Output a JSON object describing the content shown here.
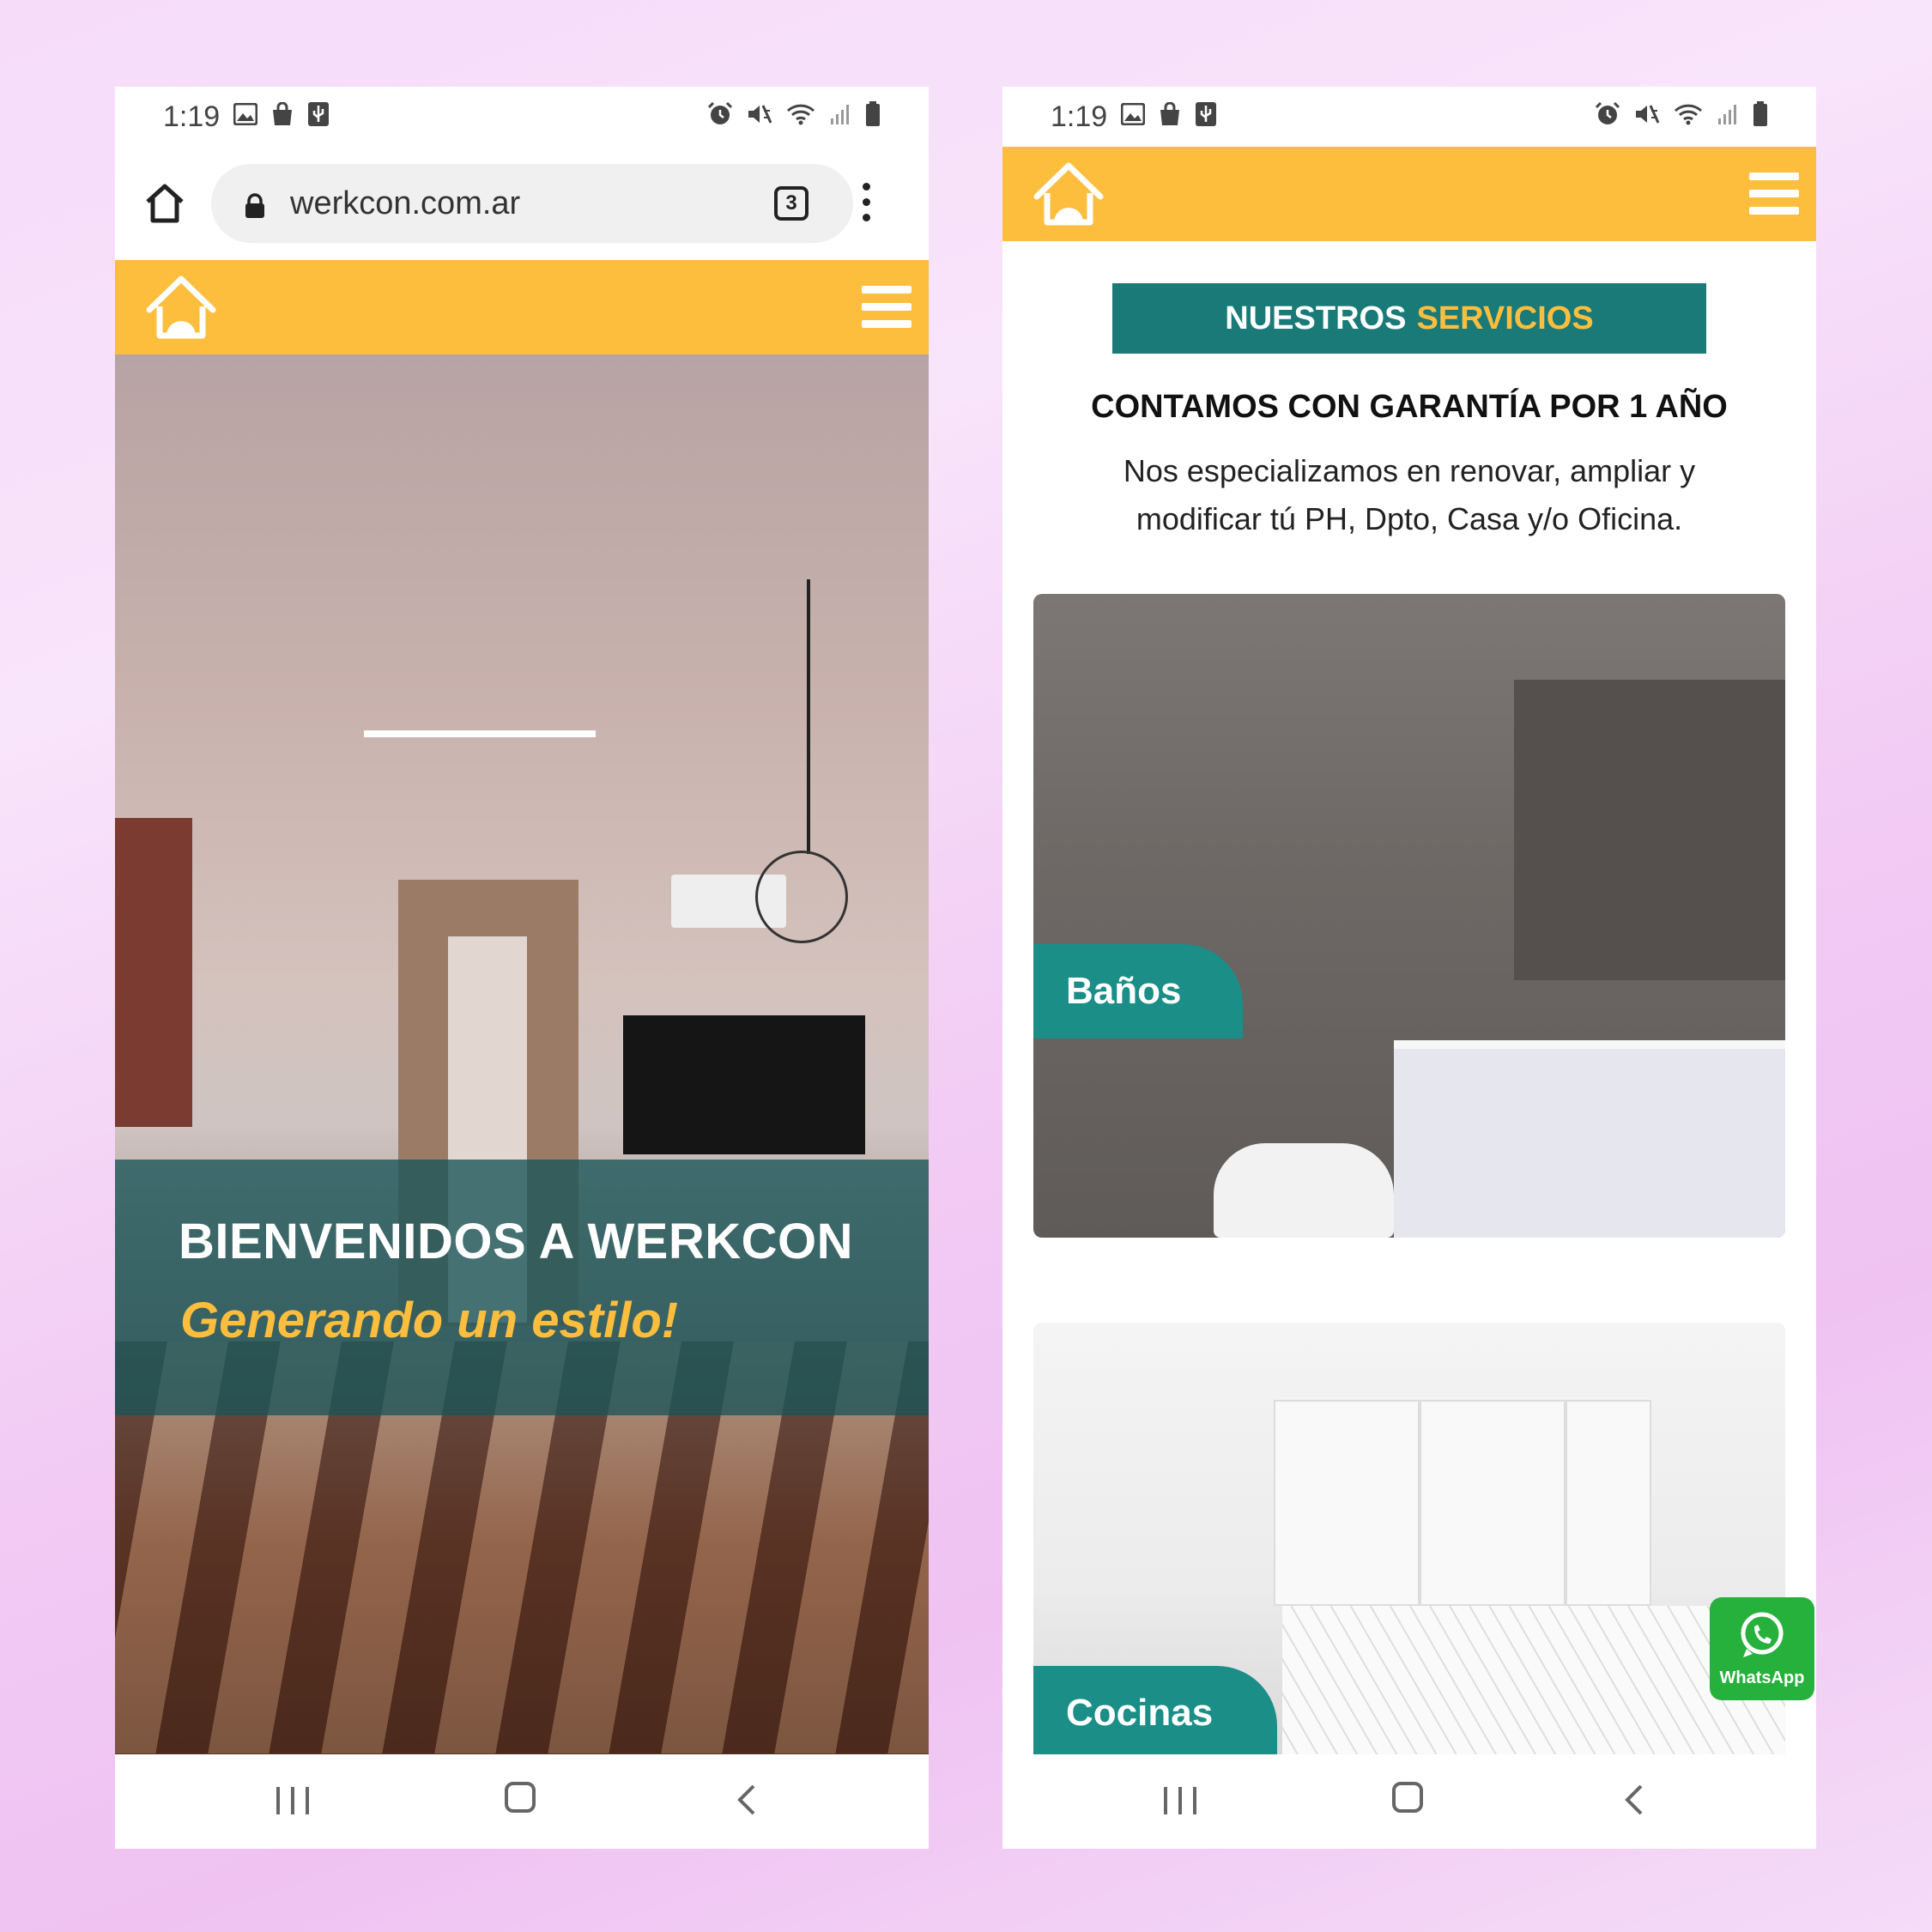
{
  "left_phone": {
    "status": {
      "time": "1:19"
    },
    "browser": {
      "url": "werkcon.com.ar",
      "tab_count": "3"
    },
    "hero": {
      "title": "BIENVENIDOS A WERKCON",
      "subtitle": "Generando un estilo!"
    }
  },
  "right_phone": {
    "status": {
      "time": "1:19"
    },
    "services": {
      "banner_part1": "NUESTROS",
      "banner_part2": "SERVICIOS",
      "guarantee": "CONTAMOS CON GARANTÍA POR 1 AÑO",
      "description": "Nos especializamos en renovar, ampliar y modificar tú PH, Dpto, Casa y/o Oficina."
    },
    "cards": [
      {
        "label": "Baños"
      },
      {
        "label": "Cocinas"
      }
    ],
    "whatsapp": {
      "label": "WhatsApp"
    }
  },
  "colors": {
    "brand_yellow": "#fdbd3d",
    "brand_teal": "#1a7a77",
    "whatsapp_green": "#26b13c"
  },
  "icons": [
    "image-icon",
    "shopping-bag-icon",
    "usb-icon",
    "alarm-icon",
    "mute-icon",
    "wifi-icon",
    "signal-icon",
    "battery-icon",
    "home-icon",
    "lock-icon",
    "tabs-icon",
    "more-vert-icon",
    "logo-house-icon",
    "hamburger-icon",
    "recent-apps-icon",
    "nav-home-icon",
    "back-icon",
    "whatsapp-icon"
  ]
}
